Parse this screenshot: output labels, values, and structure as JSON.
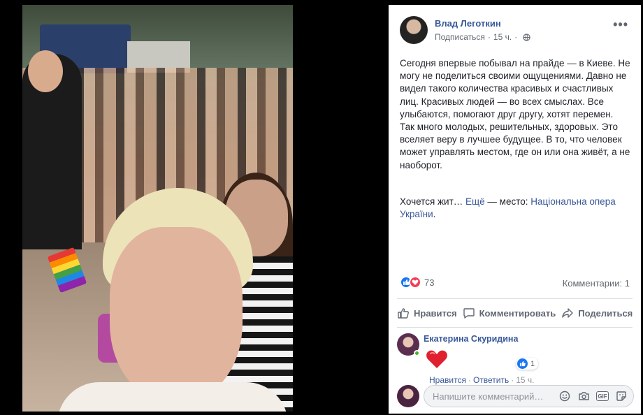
{
  "post": {
    "author": "Влад Леготкин",
    "subscribe": "Подписаться",
    "dot": "·",
    "time": "15 ч.",
    "dot2": "·",
    "more_icon": "more-horizontal-icon",
    "text": "Сегодня впервые побывал на прайде — в Киеве. Не могу не поделиться своими ощущениями. Давно не видел такого количества красивых и счастливых лиц. Красивых людей — во всех смыслах. Все улыбаются, помогают друг другу, хотят перемен. Так много молодых, решительных, здоровых. Это вселяет веру в лучшее будущее. В то, что человек может управлять местом, где он или она живёт, а не наоборот.",
    "text_cont": "Хочется жит…",
    "see_more": "Ещё",
    "place_prefix": "— место:",
    "place": "Національна опера України",
    "place_end": "."
  },
  "reactions": {
    "count": "73",
    "comments": "Комментарии: 1"
  },
  "actions": {
    "like": "Нравится",
    "comment": "Комментировать",
    "share": "Поделиться"
  },
  "comment": {
    "author": "Екатерина Скуридина",
    "likes": "1",
    "like": "Нравится",
    "reply": "Ответить",
    "time": "15 ч.",
    "sep1": "·",
    "sep2": "·"
  },
  "composer": {
    "placeholder": "Напишите комментарий…",
    "gif": "GIF"
  },
  "colors": {
    "link": "#385898",
    "like_blue": "#1877f2",
    "love_red": "#f33e58"
  }
}
